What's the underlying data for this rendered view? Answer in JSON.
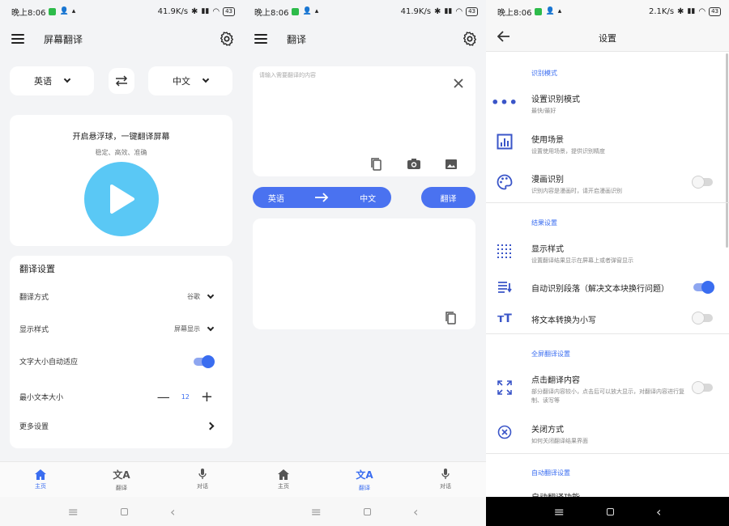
{
  "status": {
    "time": "晚上8:06",
    "speed1": "41.9K/s",
    "speed3": "2.1K/s",
    "battery": "43"
  },
  "screen1": {
    "title": "屏幕翻译",
    "source_lang": "英语",
    "target_lang": "中文",
    "float_title": "开启悬浮球，一键翻译屏幕",
    "float_sub": "稳定、高效、准确",
    "settings_title": "翻译设置",
    "rows": [
      {
        "label": "翻译方式",
        "value": "谷歌"
      },
      {
        "label": "显示样式",
        "value": "屏幕显示"
      },
      {
        "label": "文字大小自动适应"
      },
      {
        "label": "最小文本大小",
        "value": "12"
      },
      {
        "label": "更多设置"
      }
    ]
  },
  "screen2": {
    "title": "翻译",
    "placeholder": "请输入需要翻译的内容",
    "from": "英语",
    "to": "中文",
    "translate_btn": "翻译"
  },
  "nav": {
    "home": "主页",
    "translate": "翻译",
    "dialog": "对话"
  },
  "screen3": {
    "title": "设置",
    "sections": {
      "recognition": "识别模式",
      "result": "结果设置",
      "fullscreen": "全屏翻译设置",
      "auto": "自动翻译设置"
    },
    "items": {
      "mode": {
        "title": "设置识别模式",
        "sub": "最快/最好"
      },
      "scene": {
        "title": "使用场景",
        "sub": "设置使用场景，提供识别精度"
      },
      "comic": {
        "title": "漫画识别",
        "sub": "识别内容是漫画时，请开启漫画识别"
      },
      "style": {
        "title": "显示样式",
        "sub": "设置翻译结果显示在屏幕上或者弹窗显示"
      },
      "para": {
        "title": "自动识别段落（解决文本块换行问题）"
      },
      "lower": {
        "title": "将文本转换为小写"
      },
      "click": {
        "title": "点击翻译内容",
        "sub": "部分翻译内容较小，点击后可以放大显示，对翻译内容进行复制、读写等"
      },
      "close": {
        "title": "关闭方式",
        "sub": "如何关闭翻译结果界面"
      },
      "autofn": {
        "title": "自动翻译功能"
      }
    }
  },
  "colors": {
    "accent": "#3a6df0",
    "play": "#5ac8f5",
    "pill": "#4a72f0"
  }
}
